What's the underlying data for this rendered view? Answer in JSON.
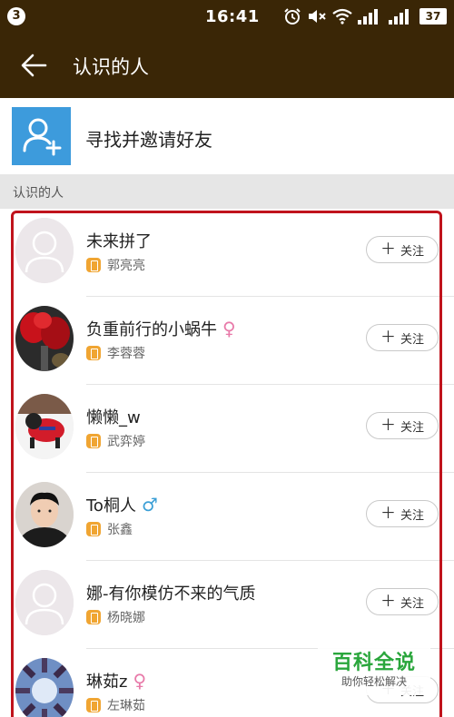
{
  "status_bar": {
    "notification_count": "3",
    "time": "16:41",
    "battery": "37",
    "icons": [
      "alarm-icon",
      "mute-icon",
      "wifi-icon",
      "signal-icon",
      "signal-icon-2"
    ]
  },
  "app_bar": {
    "title": "认识的人",
    "back_icon": "arrow-left-icon"
  },
  "invite": {
    "label": "寻找并邀请好友",
    "icon": "add-user-icon"
  },
  "section": {
    "label": "认识的人"
  },
  "people": [
    {
      "name": "未来拼了",
      "gender": "",
      "contact": "郭亮亮",
      "follow_label": "关注",
      "avatar": "default"
    },
    {
      "name": "负重前行的小蜗牛",
      "gender": "♀",
      "contact": "李蓉蓉",
      "follow_label": "关注",
      "avatar": "flowers"
    },
    {
      "name": "懒懒_w",
      "gender": "",
      "contact": "武弈婷",
      "follow_label": "关注",
      "avatar": "dog"
    },
    {
      "name": "To桐人",
      "gender": "♂",
      "contact": "张鑫",
      "follow_label": "关注",
      "avatar": "man"
    },
    {
      "name": "娜-有你模仿不来的气质",
      "gender": "",
      "contact": "杨晓娜",
      "follow_label": "关注",
      "avatar": "default"
    },
    {
      "name": "琳茹z",
      "gender": "♀",
      "contact": "左琳茹",
      "follow_label": "关注",
      "avatar": "sky"
    }
  ],
  "watermark": {
    "title": "百科全说",
    "subtitle": "助你轻松解决"
  },
  "colors": {
    "header_bg": "#3a2606",
    "invite_icon_bg": "#3d9bdc",
    "contact_badge": "#f0a532",
    "highlight_border": "#c0131c",
    "female": "#e87aa9",
    "male": "#3b9fd6"
  }
}
